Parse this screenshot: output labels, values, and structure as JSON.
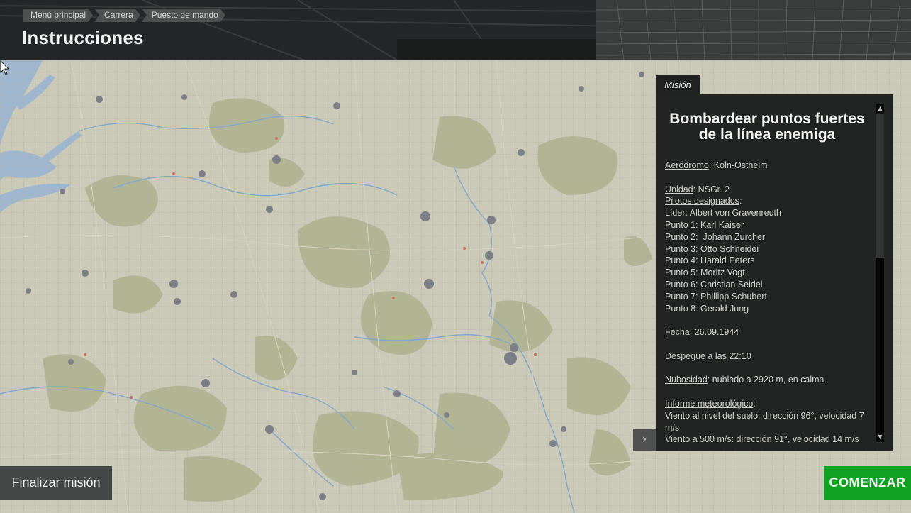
{
  "breadcrumb": {
    "items": [
      "Menú principal",
      "Carrera",
      "Puesto de mando"
    ]
  },
  "header": {
    "title": "Instrucciones"
  },
  "mission_panel": {
    "tab_label": "Misión",
    "title": "Bombardear puntos fuertes de la línea enemiga",
    "airfield_label": "Aeródromo",
    "airfield_value": "Koln-Ostheim",
    "unit_label": "Unidad",
    "unit_value": "NSGr. 2",
    "pilots_label": "Pilotos designados",
    "pilots": [
      "Líder: Albert von Gravenreuth",
      "Punto 1: Karl Kaiser",
      "Punto 2:  Johann Zurcher",
      "Punto 3: Otto Schneider",
      "Punto 4: Harald Peters",
      "Punto 5: Moritz Vogt",
      "Punto 6: Christian Seidel",
      "Punto 7: Phillipp Schubert",
      "Punto 8: Gerald Jung"
    ],
    "date_label": "Fecha",
    "date_value": "26.09.1944",
    "takeoff_label": "Despegue a las",
    "takeoff_value": "22:10",
    "clouds_label": "Nubosidad",
    "clouds_value": "nublado a 2920 m, en calma",
    "weather_label": "Informe meteorológico",
    "weather_lines": [
      "Viento al nivel del suelo: dirección 96°, velocidad 7 m/s",
      "Viento a 500 m/s: dirección 91°, velocidad 14 m/s"
    ],
    "scroll_up_glyph": "▲",
    "scroll_down_glyph": "▼"
  },
  "expand_glyph": "›",
  "buttons": {
    "end_mission": "Finalizar misión",
    "start": "COMENZAR"
  },
  "colors": {
    "start_button": "#11a223",
    "panel_bg": "#222423",
    "map_bg": "#c9c7b6",
    "water": "#9fb6cf"
  }
}
